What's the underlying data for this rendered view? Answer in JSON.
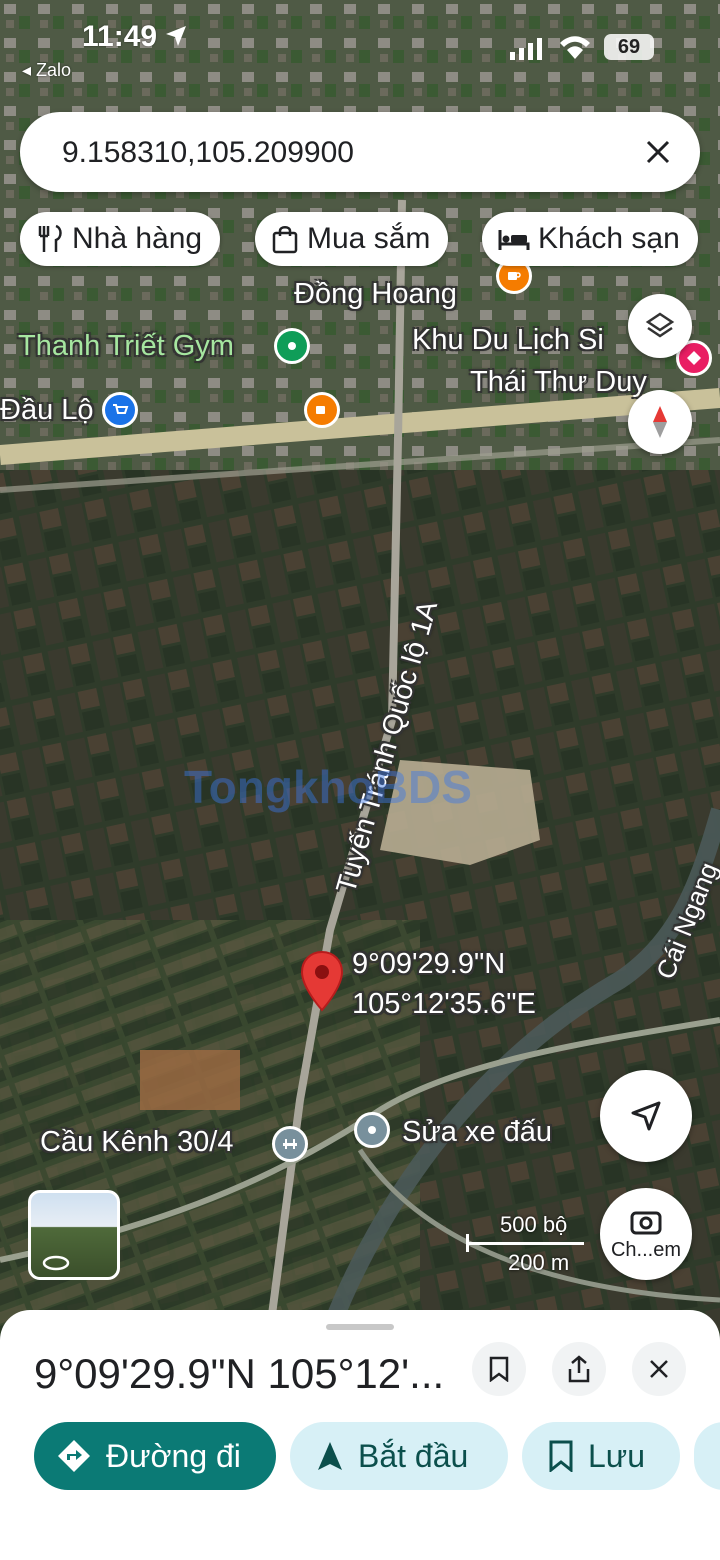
{
  "status_bar": {
    "time": "11:49",
    "back_app": "◂ Zalo",
    "battery": "69"
  },
  "search": {
    "query": "9.158310,105.209900"
  },
  "chips": [
    {
      "label": "Nhà hàng",
      "icon": "restaurant-icon"
    },
    {
      "label": "Mua sắm",
      "icon": "shopping-bag-icon"
    },
    {
      "label": "Khách sạn",
      "icon": "hotel-bed-icon"
    }
  ],
  "map": {
    "labels": {
      "dong_hoang": "Đồng Hoang",
      "gym": "Thanh Triết Gym",
      "tourism": "Khu Du Lịch Si",
      "tourism2": "Thái Thư Duy",
      "dau_lo": "Đầu Lộ",
      "road": "Tuyến Tránh Quốc lộ 1A",
      "cai_ngang": "Cái Ngang",
      "bridge": "Cầu Kênh 30/4",
      "repair": "Sửa xe đấu",
      "watermark": "TongkhoBDS"
    },
    "pin": {
      "lat": "9°09'29.9\"N",
      "lng": "105°12'35.6\"E"
    },
    "scale": {
      "feet": "500 bộ",
      "meters": "200 m"
    },
    "streetview_label": "Ch...em"
  },
  "place": {
    "title": "9°09'29.9\"N 105°12'...",
    "actions": {
      "directions": "Đường đi",
      "start": "Bắt đầu",
      "save": "Lưu"
    }
  },
  "colors": {
    "accent": "#0b7a75",
    "chip_bg": "#d7f0f6",
    "pin": "#e53935",
    "poi_orange": "#f57c00",
    "poi_blue": "#1a73e8",
    "poi_green": "#0f9d58"
  }
}
